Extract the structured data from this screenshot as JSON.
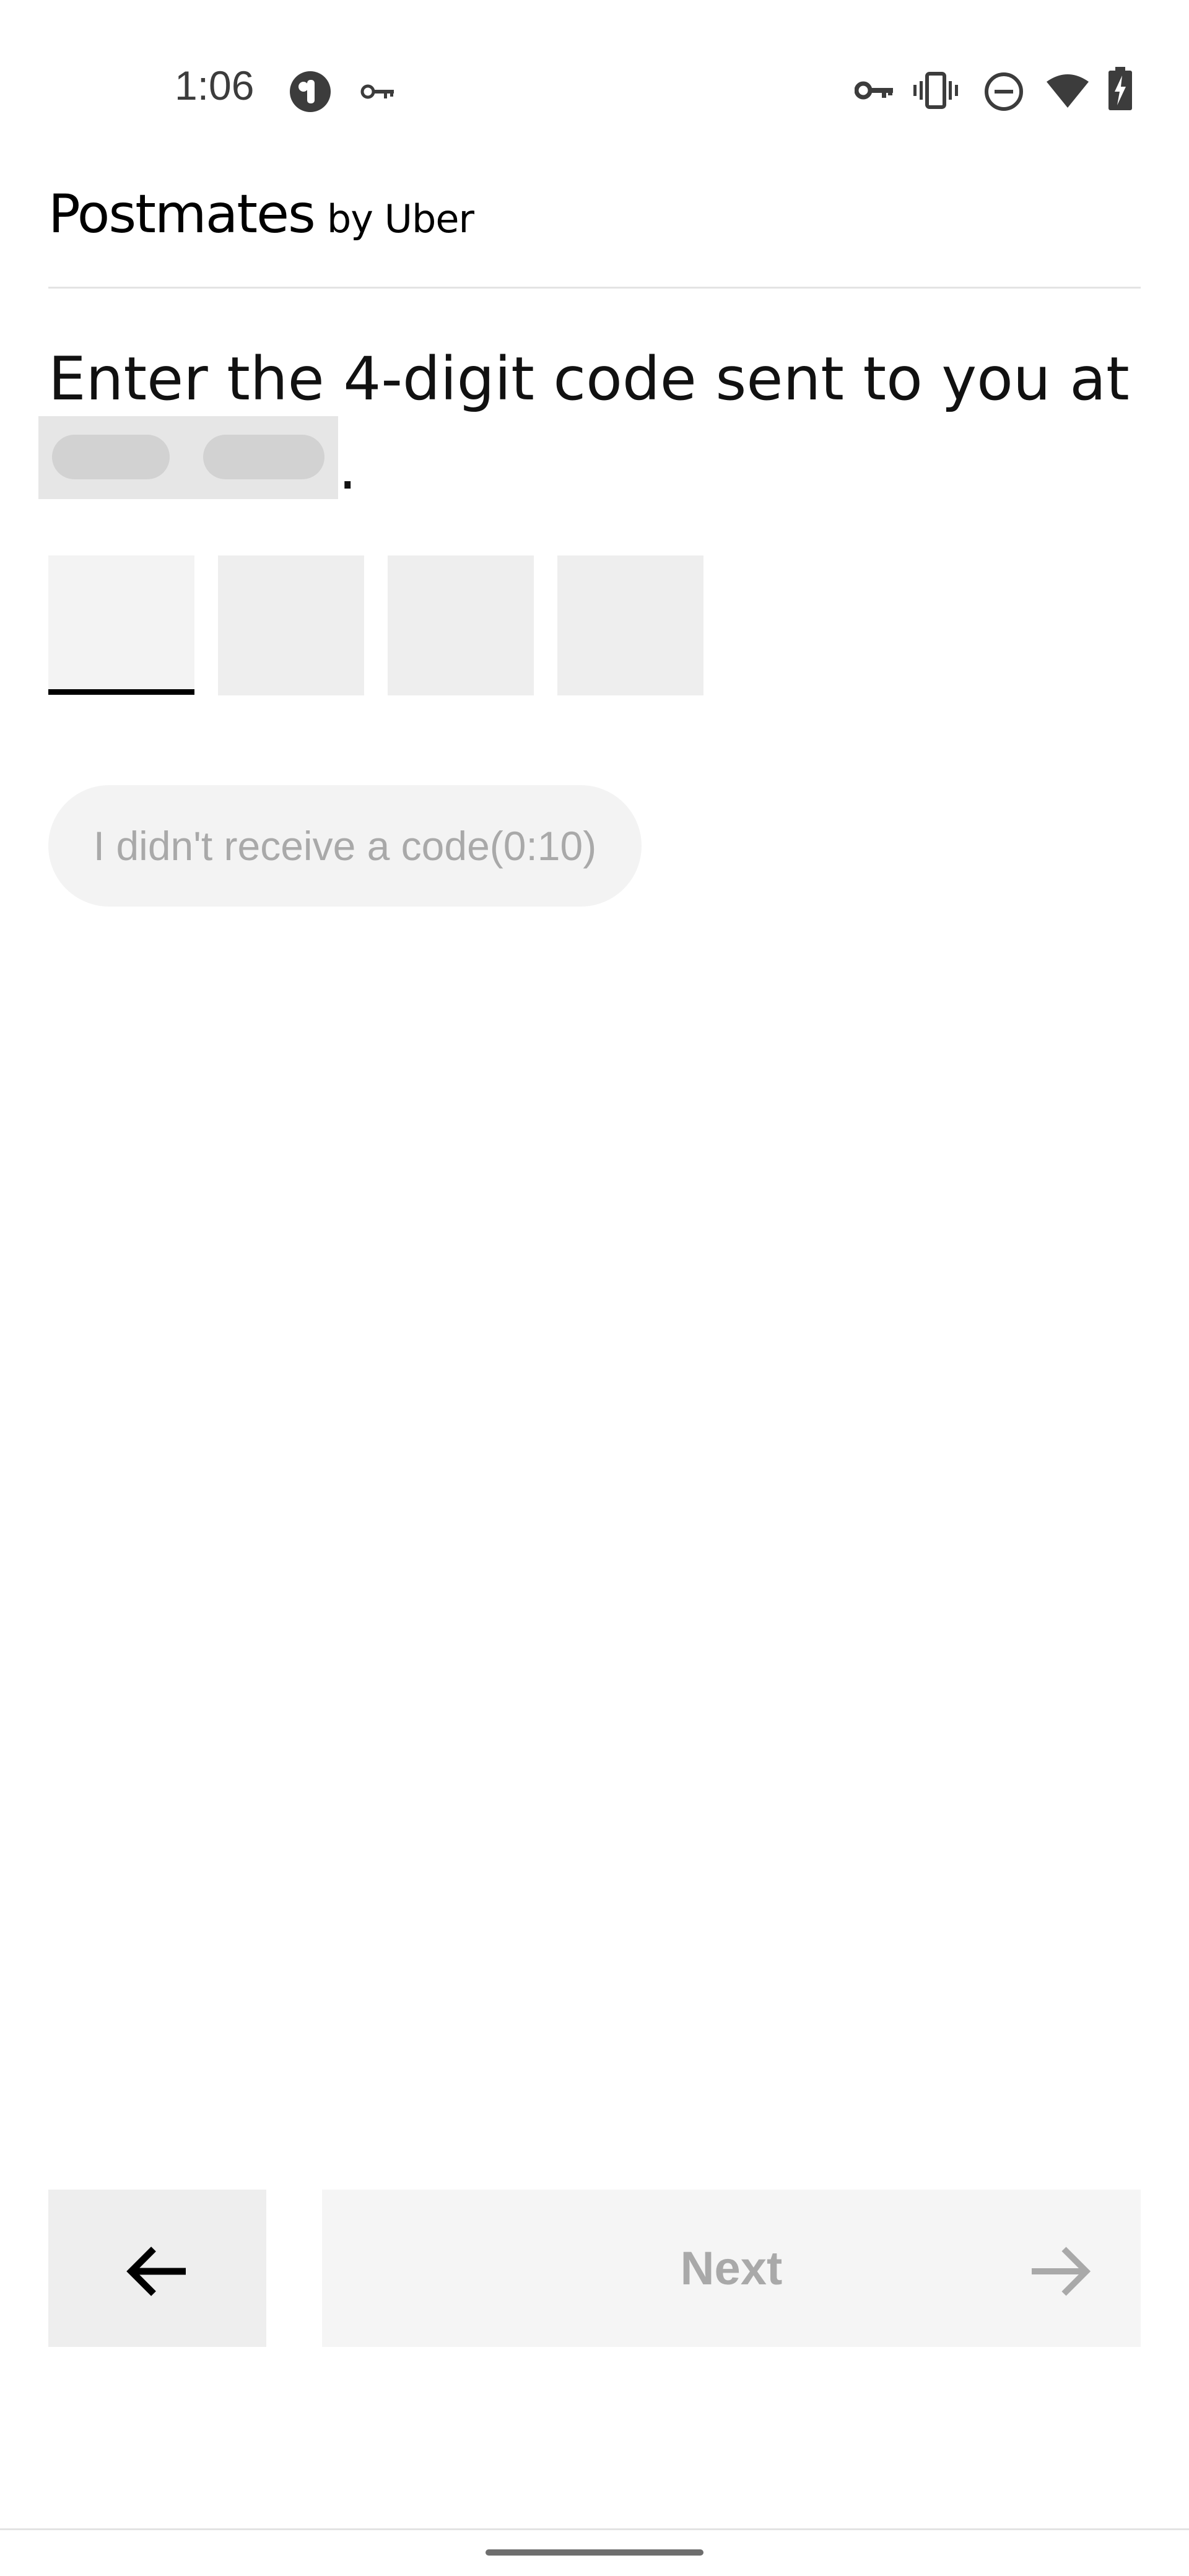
{
  "status_bar": {
    "time": "1:06",
    "icons": [
      "app-notification-icon",
      "key-icon",
      "vpn-key-icon",
      "vibrate-icon",
      "do-not-disturb-icon",
      "wifi-icon",
      "battery-charging-icon"
    ]
  },
  "header": {
    "brand_main": "Postmates",
    "brand_sub": "by Uber"
  },
  "prompt": {
    "title": "Enter the 4-digit code sent to you at",
    "phone_number_redacted": true,
    "trailing_period": "."
  },
  "code_input": {
    "digit_count": 4,
    "values": [
      "",
      "",
      "",
      ""
    ],
    "active_index": 0
  },
  "resend": {
    "label": "I didn't receive a code(0:10)"
  },
  "footer": {
    "back_icon": "arrow-left-icon",
    "next_label": "Next",
    "next_icon": "arrow-right-icon"
  },
  "colors": {
    "accent": "#000000",
    "disabled_text": "#a9a9a9",
    "input_bg": "#eeeeee",
    "divider": "#e3e3e3"
  }
}
